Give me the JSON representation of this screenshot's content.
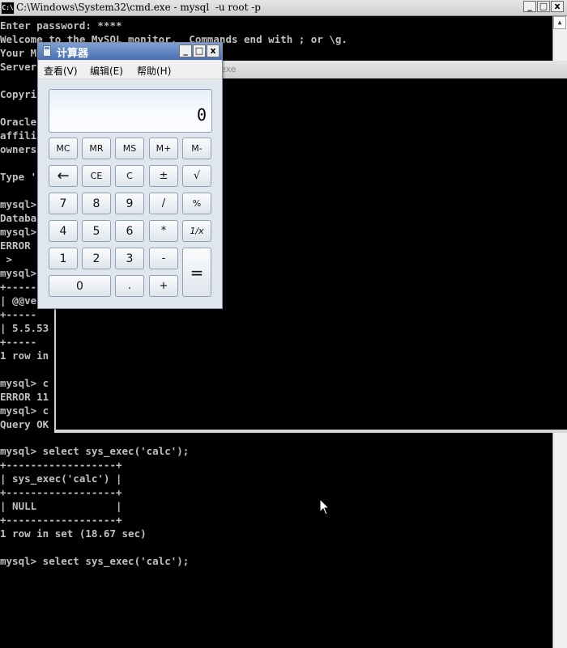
{
  "console_window": {
    "title": "C:\\Windows\\System32\\cmd.exe - mysql  -u root -p",
    "icon_text": "C:\\",
    "buttons": {
      "minimize": "_",
      "maximize": "□",
      "close": "x"
    },
    "top_lines": [
      "Enter password: ****",
      "Welcome to the MySQL monitor.  Commands end with ; or \\g.",
      "Your M",
      "Server",
      "",
      "Copyri",
      "",
      "Oracle",
      "affili",
      "owners",
      "",
      "Type '",
      "",
      "mysql>",
      "Databa",
      "mysql>",
      "ERROR",
      " >",
      "mysql>",
      "+-----",
      "| @@ve",
      "+-----",
      "| 5.5.53",
      "+-----",
      "1 row in",
      "",
      "mysql> c",
      "ERROR 11",
      "mysql> c",
      "Query OK"
    ],
    "bottom_lines": [
      "mysql> select sys_exec('calc');",
      "+------------------+",
      "| sys_exec('calc') |",
      "+------------------+",
      "| NULL             |",
      "+------------------+",
      "1 row in set (18.67 sec)",
      "",
      "mysql> select sys_exec('calc');"
    ]
  },
  "console_window_2": {
    "title": "exe"
  },
  "calculator": {
    "title": "计算器",
    "menu": [
      "查看(V)",
      "编辑(E)",
      "帮助(H)"
    ],
    "display": "0",
    "buttons": {
      "mc": "MC",
      "mr": "MR",
      "ms": "MS",
      "m_plus": "M+",
      "m_minus": "M-",
      "backspace": "←",
      "ce": "CE",
      "c": "C",
      "plus_minus": "±",
      "sqrt": "√",
      "seven": "7",
      "eight": "8",
      "nine": "9",
      "divide": "/",
      "percent": "%",
      "four": "4",
      "five": "5",
      "six": "6",
      "multiply": "*",
      "reciprocal": "1/x",
      "one": "1",
      "two": "2",
      "three": "3",
      "minus": "-",
      "equals": "=",
      "zero": "0",
      "decimal": ".",
      "plus": "+"
    },
    "colors": {
      "titlebar": "#4b6fb3",
      "body": "#dfe6ee"
    }
  },
  "console_colors": {
    "background": "#000000",
    "text": "#c0c0c0"
  }
}
